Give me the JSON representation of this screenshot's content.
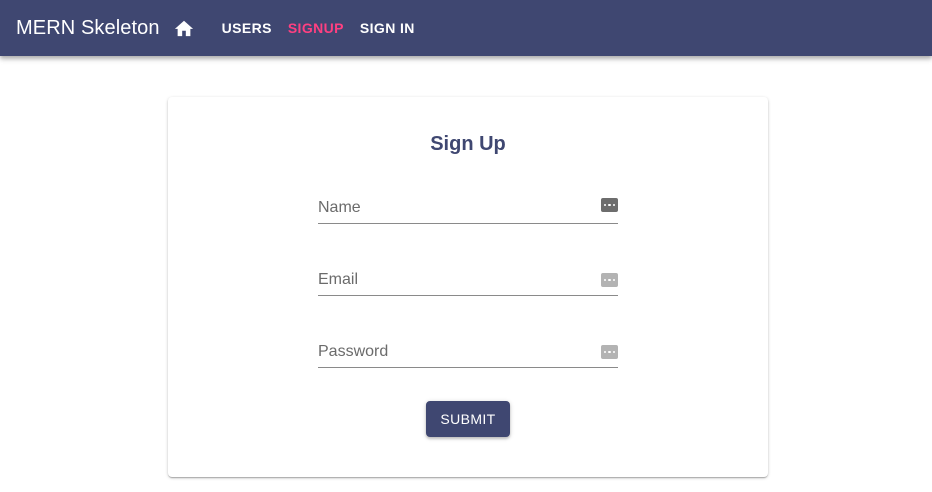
{
  "appbar": {
    "brand": "MERN Skeleton",
    "home_icon": "home-icon",
    "nav": [
      {
        "label": "USERS",
        "color": "#ffffff"
      },
      {
        "label": "SIGNUP",
        "color": "#ff4081"
      },
      {
        "label": "SIGN IN",
        "color": "#ffffff"
      }
    ],
    "background": "#3f4771"
  },
  "form": {
    "title": "Sign Up",
    "fields": [
      {
        "placeholder": "Name",
        "value": "",
        "type": "text",
        "icon": "password-dots-icon"
      },
      {
        "placeholder": "Email",
        "value": "",
        "type": "email",
        "icon": "password-dots-icon"
      },
      {
        "placeholder": "Password",
        "value": "",
        "type": "password",
        "icon": "password-dots-icon"
      }
    ],
    "submit_label": "SUBMIT"
  }
}
